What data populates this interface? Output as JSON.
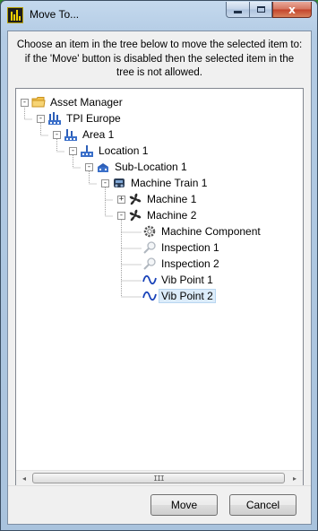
{
  "window": {
    "title": "Move To...",
    "close_glyph": "x"
  },
  "instruction": "Choose an item in the tree below to move the selected item to: if the 'Move' button is disabled then the selected item in the tree is not allowed.",
  "tree": {
    "items": [
      {
        "label": "Asset Manager",
        "icon": "folder-icon",
        "expander": "-"
      },
      {
        "label": "TPI Europe",
        "icon": "factory-icon",
        "expander": "-"
      },
      {
        "label": "Area 1",
        "icon": "factory-icon",
        "expander": "-"
      },
      {
        "label": "Location 1",
        "icon": "location-icon",
        "expander": "-"
      },
      {
        "label": "Sub-Location 1",
        "icon": "sub-location-icon",
        "expander": "-"
      },
      {
        "label": "Machine Train 1",
        "icon": "machine-train-icon",
        "expander": "-"
      },
      {
        "label": "Machine 1",
        "icon": "fan-icon",
        "expander": "+"
      },
      {
        "label": "Machine 2",
        "icon": "fan-icon",
        "expander": "-"
      },
      {
        "label": "Machine Component",
        "icon": "gear-icon"
      },
      {
        "label": "Inspection 1",
        "icon": "magnifier-icon"
      },
      {
        "label": "Inspection 2",
        "icon": "magnifier-icon"
      },
      {
        "label": "Vib Point 1",
        "icon": "waveform-icon"
      },
      {
        "label": "Vib Point 2",
        "icon": "waveform-icon",
        "selected": true
      }
    ]
  },
  "scrollbar": {
    "left_arrow": "◂",
    "right_arrow": "▸",
    "grip": "III"
  },
  "buttons": {
    "move": "Move",
    "cancel": "Cancel"
  },
  "colors": {
    "title_bar": "#b8cfe7",
    "close_button": "#c94a30",
    "selection": "#dcecfa",
    "background_desktop": "#2f8a2c"
  }
}
